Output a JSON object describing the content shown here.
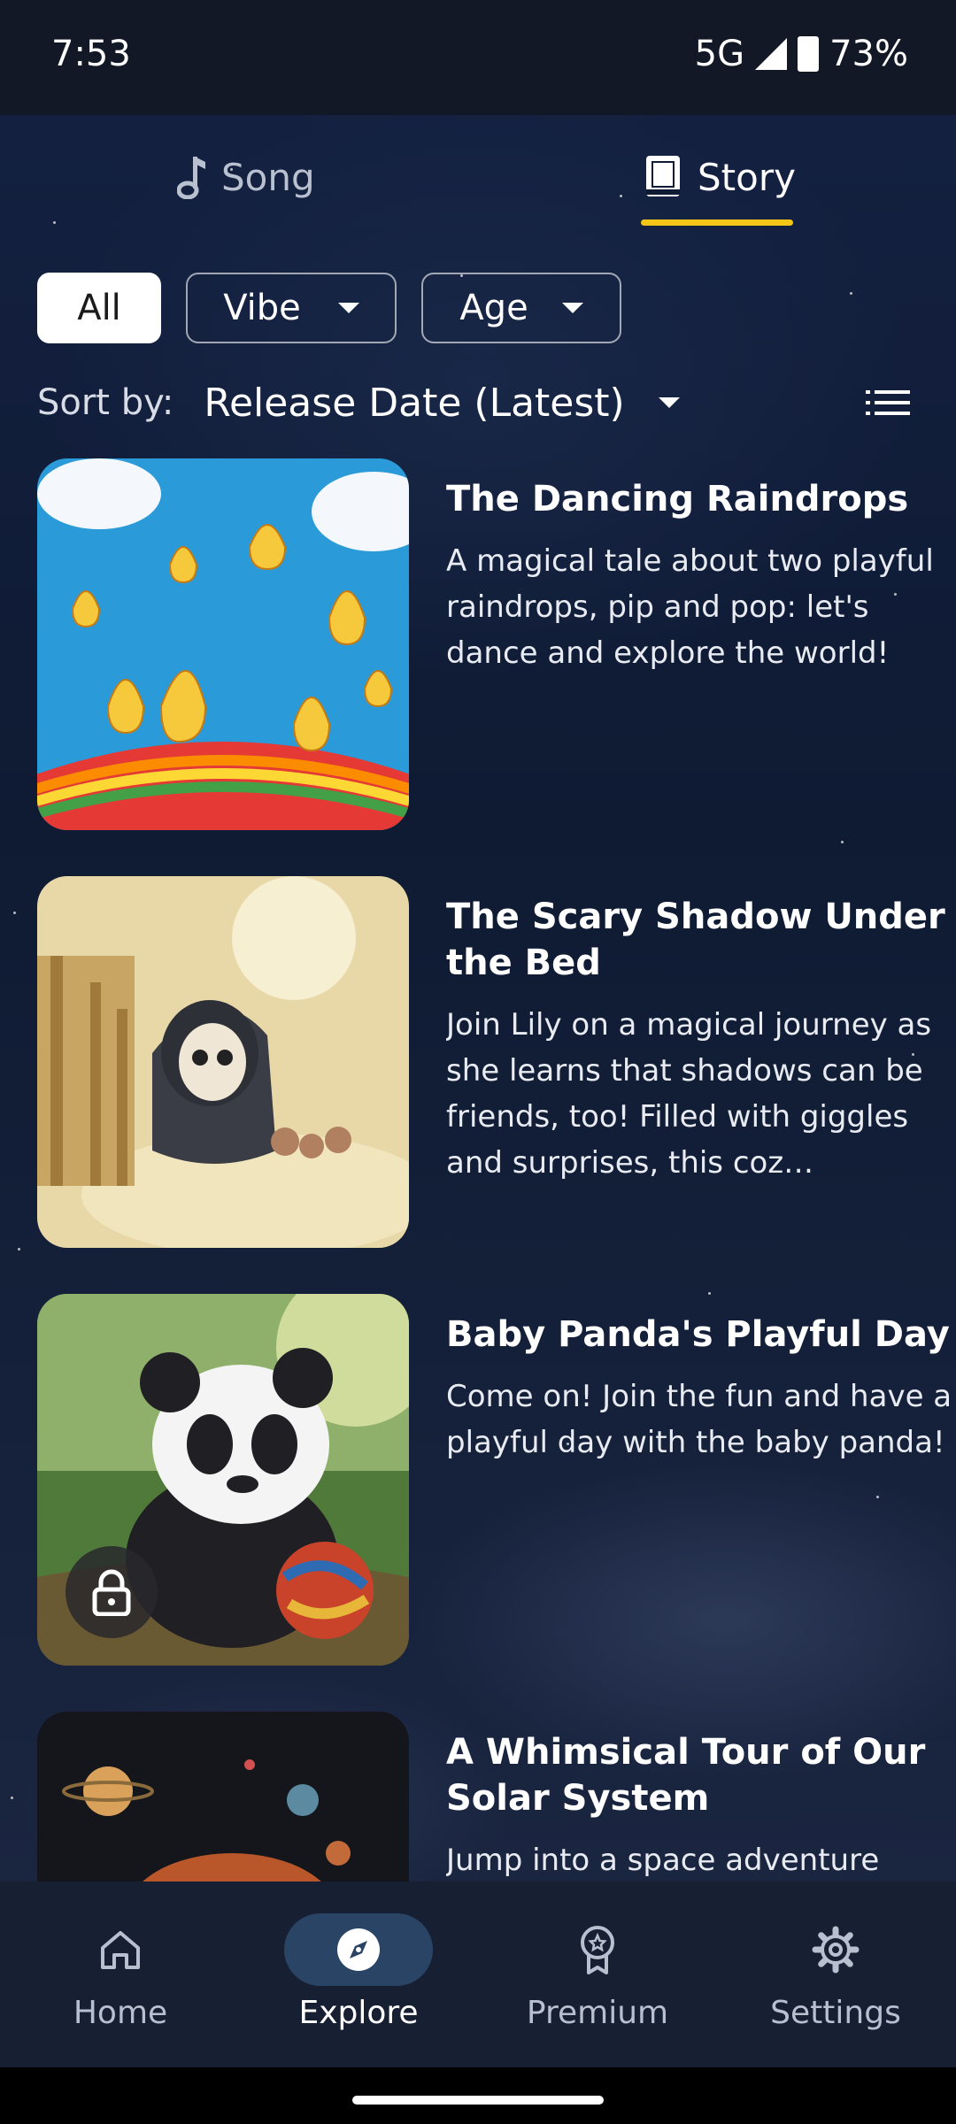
{
  "status_bar": {
    "time": "7:53",
    "network": "5G",
    "battery": "73%"
  },
  "tabs": [
    {
      "label": "Song",
      "icon": "music-note-icon",
      "active": false
    },
    {
      "label": "Story",
      "icon": "book-icon",
      "active": true
    }
  ],
  "accent_color": "#f5c518",
  "filters": {
    "all": "All",
    "vibe": "Vibe",
    "age": "Age"
  },
  "sort": {
    "label": "Sort by:",
    "value": "Release Date (Latest)"
  },
  "stories": [
    {
      "title": "The Dancing Raindrops",
      "description": "A magical tale about two playful raindrops, pip and pop: let's dance and explore the world!",
      "locked": false
    },
    {
      "title": "The Scary Shadow Under the Bed",
      "description": "Join Lily on a magical journey as she learns that shadows can be friends, too! Filled with giggles and surprises, this coz…",
      "locked": false
    },
    {
      "title": "Baby Panda's Playful Day",
      "description": "Come on! Join the fun and have a playful day with the baby panda!",
      "locked": true
    },
    {
      "title": "A Whimsical Tour of Our Solar System",
      "description": "Jump into a space adventure",
      "locked": false
    }
  ],
  "bottom_nav": [
    {
      "label": "Home",
      "icon": "home-icon"
    },
    {
      "label": "Explore",
      "icon": "compass-icon",
      "active": true
    },
    {
      "label": "Premium",
      "icon": "award-icon"
    },
    {
      "label": "Settings",
      "icon": "gear-icon"
    }
  ]
}
